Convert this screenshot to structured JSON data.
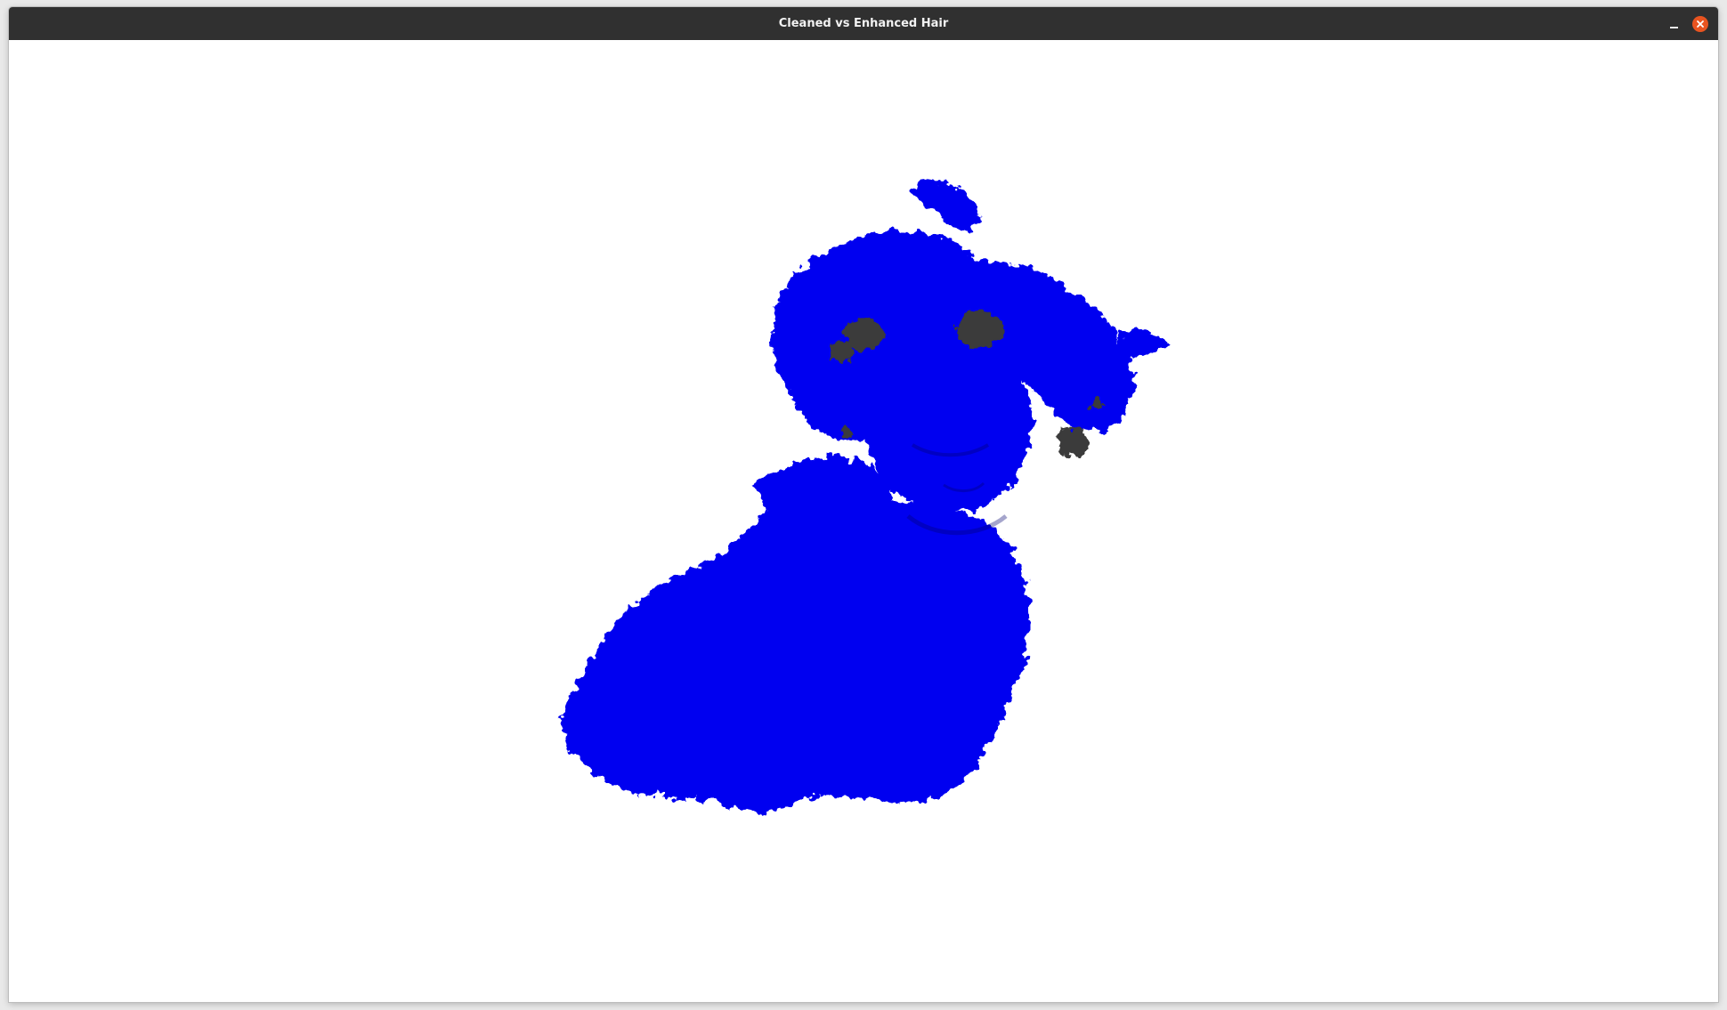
{
  "window": {
    "title": "Cleaned vs Enhanced Hair"
  },
  "controls": {
    "minimize_icon": "minimize-icon",
    "close_icon": "close-icon"
  },
  "viewer": {
    "point_colors": {
      "cleaned": "#0000f0",
      "enhanced_hair": "#3a3a3a"
    }
  }
}
